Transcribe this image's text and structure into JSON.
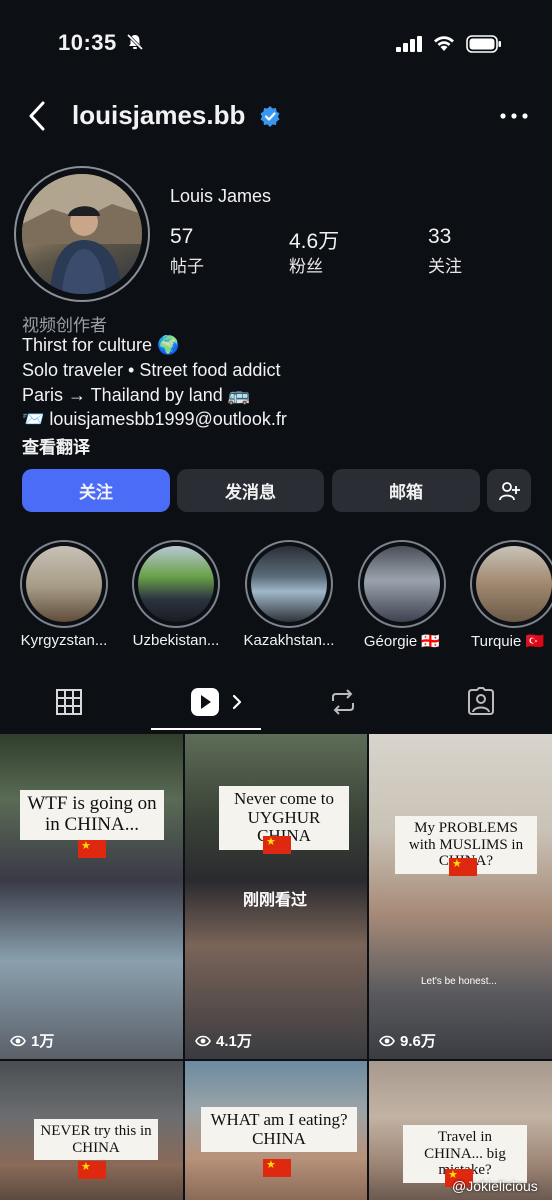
{
  "status_bar": {
    "time": "10:35"
  },
  "header": {
    "username": "louisjames.bb"
  },
  "profile": {
    "display_name": "Louis James",
    "stats": [
      {
        "value": "57",
        "label": "帖子"
      },
      {
        "value": "4.6万",
        "label": "粉丝"
      },
      {
        "value": "33",
        "label": "关注"
      }
    ],
    "category": "视频创作者",
    "bio": [
      "Thirst for culture 🌍",
      "Solo traveler • Street food addict",
      "Paris → Thailand by land 🚌",
      "📨 louisjamesbb1999@outlook.fr"
    ],
    "translate": "查看翻译"
  },
  "buttons": {
    "follow": "关注",
    "message": "发消息",
    "email": "邮箱"
  },
  "highlights": [
    {
      "label": "Kyrgyzstan..."
    },
    {
      "label": "Uzbekistan..."
    },
    {
      "label": "Kazakhstan..."
    },
    {
      "label": "Géorgie 🇬🇪"
    },
    {
      "label": "Turquie 🇹🇷"
    }
  ],
  "reels": [
    {
      "caption": "WTF is going on in CHINA...",
      "views": "1万"
    },
    {
      "caption": "Never come to UYGHUR CHINA",
      "views": "4.1万",
      "overlay": "刚刚看过"
    },
    {
      "caption": "My PROBLEMS with MUSLIMS in CHINA?",
      "views": "9.6万",
      "subtitle": "Let's be honest..."
    },
    {
      "caption": "NEVER try this in CHINA"
    },
    {
      "caption": "WHAT am I eating? CHINA"
    },
    {
      "caption": "Travel in CHINA... big mistake?"
    }
  ],
  "watermark": "@Jokielicious",
  "colors": {
    "accent": "#4b6cf7",
    "verified": "#3897f0",
    "background": "#0c0f14"
  }
}
